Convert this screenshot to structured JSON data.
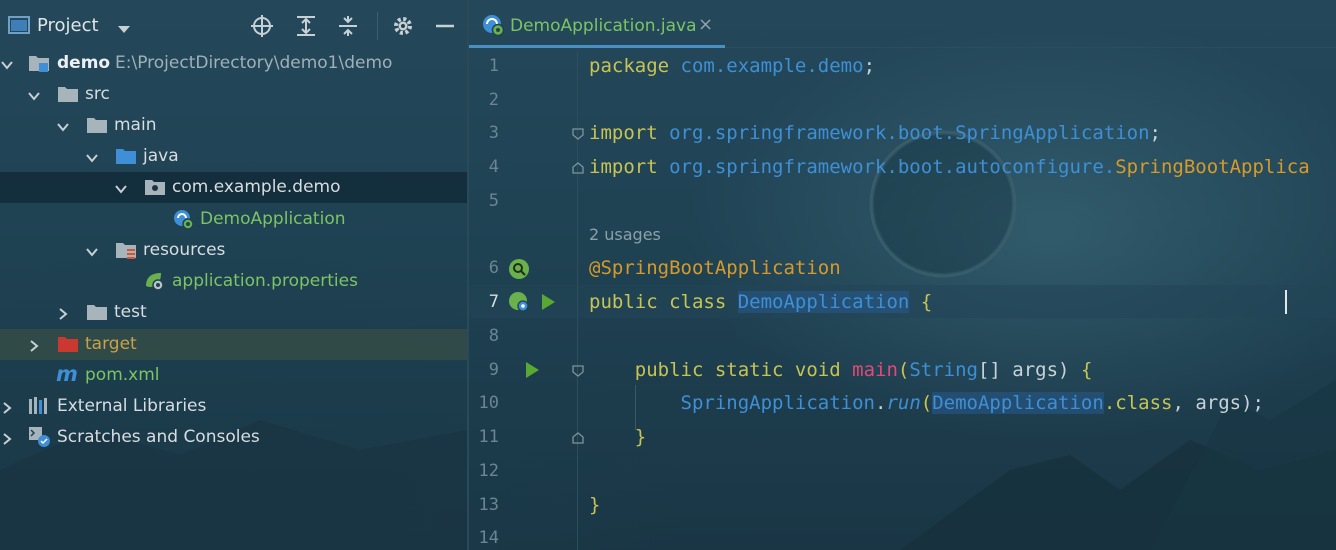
{
  "project_panel": {
    "title": "Project",
    "tree": [
      {
        "label": "demo",
        "path": "E:\\ProjectDirectory\\demo1\\demo"
      },
      {
        "label": "src"
      },
      {
        "label": "main"
      },
      {
        "label": "java"
      },
      {
        "label": "com.example.demo"
      },
      {
        "label": "DemoApplication"
      },
      {
        "label": "resources"
      },
      {
        "label": "application.properties"
      },
      {
        "label": "test"
      },
      {
        "label": "target"
      },
      {
        "label": "pom.xml"
      },
      {
        "label": "External Libraries"
      },
      {
        "label": "Scratches and Consoles"
      }
    ]
  },
  "editor": {
    "tab": {
      "label": "DemoApplication.java",
      "close": "×"
    },
    "line_numbers": [
      "1",
      "2",
      "3",
      "4",
      "5",
      "6",
      "7",
      "8",
      "9",
      "10",
      "11",
      "12",
      "13",
      "14"
    ],
    "usages_hint": "2 usages",
    "code": {
      "l1_kw": "package",
      "l1_pkg": "com.example.demo",
      "l1_end": ";",
      "l3_kw": "import",
      "l3_pkg": "org.springframework.boot.",
      "l3_cls": "SpringApplication",
      "l3_end": ";",
      "l4_kw": "import",
      "l4_pkg": "org.springframework.boot.autoconfigure.",
      "l4_cls": "SpringBootApplica",
      "l6_ann": "@SpringBootApplication",
      "l7_kw": "public class",
      "l7_cls": "DemoApplication",
      "l7_end": "{",
      "l9_kw": "public static void",
      "l9_fn": "main",
      "l9_open": "(",
      "l9_type": "String",
      "l9_rest": "[] args)",
      "l9_brace": "{",
      "l10_cls": "SpringApplication",
      "l10_dot": ".",
      "l10_fn": "run",
      "l10_open": "(",
      "l10_arg": "DemoApplication",
      "l10_kw": ".class",
      "l10_rest": ", args);",
      "l11": "}",
      "l13": "}"
    }
  },
  "colors": {
    "keyword": "#c7c454",
    "package": "#3e8fd6",
    "annotation": "#d79a2a",
    "method": "#e04a78",
    "source_file": "#7cc465",
    "excluded_folder": "#c9a14a"
  }
}
